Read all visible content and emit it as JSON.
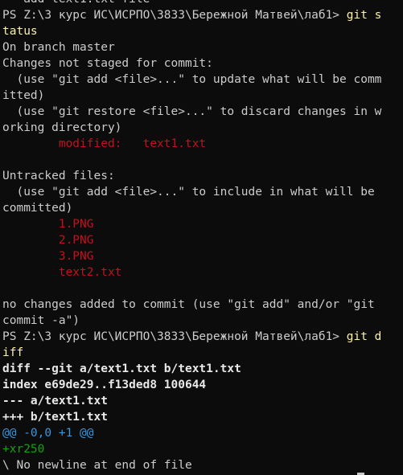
{
  "terminal": {
    "top_partial": "   add text1.txt file",
    "prompt1": "PS Z:\\3 курс ИС\\ИСРПО\\3833\\Бережной Матвей\\лаб1>",
    "cmd1_part1": "git s",
    "cmd1_part2": "tatus",
    "branch_line": "On branch master",
    "changes_header": "Changes not staged for commit:",
    "hint_add_1": "  (use \"git add <file>...\" to update what will be comm",
    "hint_add_2": "itted)",
    "hint_restore_1": "  (use \"git restore <file>...\" to discard changes in w",
    "hint_restore_2": "orking directory)",
    "modified_entry": "        modified:   text1.txt",
    "untracked_header": "Untracked files:",
    "hint_untracked_1": "  (use \"git add <file>...\" to include in what will be",
    "hint_untracked_2": "committed)",
    "untracked_files": [
      "        1.PNG",
      "        2.PNG",
      "        3.PNG",
      "        text2.txt"
    ],
    "no_changes_1": "no changes added to commit (use \"git add\" and/or \"git",
    "no_changes_2": "commit -a\")",
    "prompt2": "PS Z:\\3 курс ИС\\ИСРПО\\3833\\Бережной Матвей\\лаб1>",
    "cmd2_part1": "git d",
    "cmd2_part2": "iff",
    "diff_header": "diff --git a/text1.txt b/text1.txt",
    "diff_index": "index e69de29..f13ded8 100644",
    "diff_old": "--- a/text1.txt",
    "diff_new": "+++ b/text1.txt",
    "diff_hunk": "@@ -0,0 +1 @@",
    "diff_added": "+xr250",
    "diff_no_newline": "\\ No newline at end of file"
  },
  "colors": {
    "background": "#0c0c0c",
    "foreground": "#cccccc",
    "red": "#c50f1f",
    "command_yellow": "#f9f1a5",
    "cyan": "#3a96dd",
    "green": "#13a10e"
  }
}
